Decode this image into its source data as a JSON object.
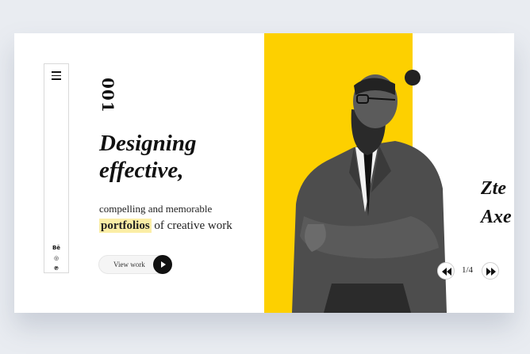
{
  "hero": {
    "slide_number": "001",
    "headline_line1": "Designing",
    "headline_line2": "effective,",
    "subtext": "compelling and memorable",
    "highlight_word": "portfolios",
    "subtext_tail": " of creative work",
    "cta_label": "View work"
  },
  "sidebar": {
    "menu_icon": "hamburger-menu-icon",
    "social": [
      {
        "icon": "behance-icon",
        "glyph": "Bē"
      },
      {
        "icon": "dribbble-icon",
        "glyph": "◎"
      },
      {
        "icon": "pinterest-icon",
        "glyph": "℗"
      }
    ]
  },
  "next_slide": {
    "title_line1": "Zte",
    "title_line2": "Axe"
  },
  "pager": {
    "current": "1/4"
  },
  "colors": {
    "accent": "#fdd000",
    "highlight": "#fbeea6",
    "background": "#e9ecf1",
    "text": "#111111"
  }
}
